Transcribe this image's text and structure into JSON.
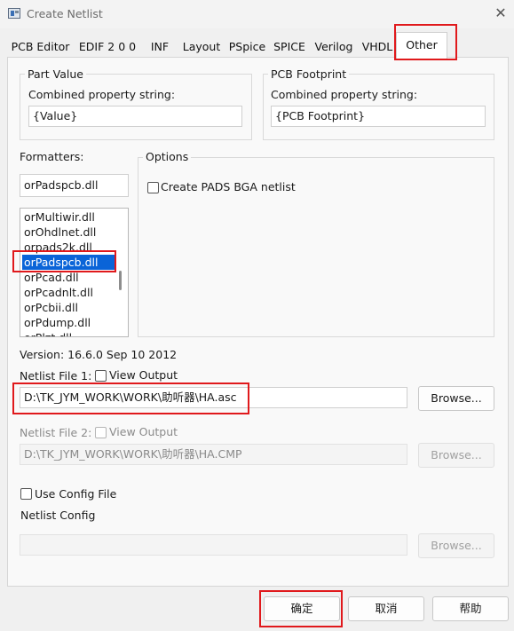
{
  "window": {
    "title": "Create Netlist",
    "close": "✕"
  },
  "tabs": [
    "PCB Editor",
    "EDIF 2 0 0",
    "INF",
    "Layout",
    "PSpice",
    "SPICE",
    "Verilog",
    "VHDL",
    "Other"
  ],
  "part_value": {
    "legend": "Part Value",
    "label": "Combined property string:",
    "value": "{Value}"
  },
  "pcb_footprint": {
    "legend": "PCB Footprint",
    "label": "Combined property string:",
    "value": "{PCB Footprint}"
  },
  "formatters": {
    "label": "Formatters:",
    "current": "orPadspcb.dll",
    "items": [
      "orMultiwir.dll",
      "orOhdlnet.dll",
      "orpads2k.dll",
      "orPadspcb.dll",
      "orPcad.dll",
      "orPcadnlt.dll",
      "orPcbii.dll",
      "orPdump.dll",
      "orPlzt.dll"
    ],
    "selected_index": 3
  },
  "options": {
    "legend": "Options",
    "create_pads_bga": {
      "label": "Create PADS BGA netlist",
      "checked": false
    }
  },
  "version": "Version: 16.6.0  Sep 10 2012",
  "netlist_file_1": {
    "label": "Netlist File 1:",
    "view_output": "View Output",
    "value": "D:\\TK_JYM_WORK\\WORK\\助听器\\HA.asc",
    "browse": "Browse..."
  },
  "netlist_file_2": {
    "label": "Netlist File 2:",
    "view_output": "View Output",
    "value": "D:\\TK_JYM_WORK\\WORK\\助听器\\HA.CMP",
    "browse": "Browse..."
  },
  "config": {
    "use_label": "Use Config File",
    "label": "Netlist Config",
    "value": "",
    "browse": "Browse..."
  },
  "footer": {
    "ok": "确定",
    "cancel": "取消",
    "help": "帮助"
  },
  "colors": {
    "highlight": "#e0191c",
    "selection": "#0a64d8"
  }
}
